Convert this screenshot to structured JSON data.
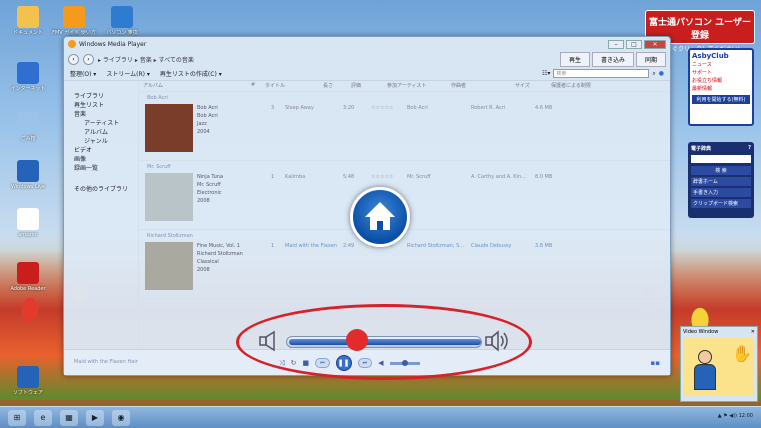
{
  "desktop": {
    "icons": [
      {
        "label": "ドキュメント",
        "color": "#f2c14e"
      },
      {
        "label": "FMV ガイド 使い方 検索",
        "color": "#f59a1c"
      },
      {
        "label": "パソコン 乗換",
        "color": "#2f7bd0"
      },
      {
        "label": "インターネット",
        "color": "#2f6fd0"
      },
      {
        "label": "ごみ箱",
        "color": "#9cc4ea"
      },
      {
        "label": "Windows Live",
        "color": "#2563b8"
      },
      {
        "label": "amazon",
        "color": "#ffffff"
      },
      {
        "label": "Adobe Reader",
        "color": "#c81e1e"
      },
      {
        "label": "ソフトウェア",
        "color": "#2563b8"
      }
    ],
    "banner": {
      "line1": "富士通パソコン ユーザー登録",
      "line2": "今すぐクリックしてください!"
    }
  },
  "gadget": {
    "brand": "AsbyClub",
    "items": [
      "ニュース",
      "サポート",
      "お役立ち情報",
      "最新情報"
    ],
    "button": "利用を開始する(無料)"
  },
  "dictionary": {
    "title": "電子辞典",
    "search": "検 索",
    "items": [
      "辞書ホーム",
      "手書き入力",
      "クリップボード検索"
    ]
  },
  "video_window": {
    "title": "Video Window"
  },
  "wmp": {
    "title": "Windows Media Player",
    "breadcrumb": "▸ ライブラリ ▸ 音楽 ▸ すべての音楽",
    "tabs": [
      "再生",
      "書き込み",
      "同期"
    ],
    "commands": [
      "整理(O) ▾",
      "ストリーム(R) ▾",
      "再生リストの作成(C) ▾"
    ],
    "search_placeholder": "検索",
    "nav": {
      "library": "ライブラリ",
      "playlists": "再生リスト",
      "music": "音楽",
      "artist": "アーティスト",
      "album": "アルバム",
      "genre": "ジャンル",
      "video": "ビデオ",
      "pictures": "画像",
      "recorded_tv": "録画一覧",
      "other": "その他のライブラリ"
    },
    "columns": [
      "アルバム",
      "#",
      "タイトル",
      "長さ",
      "評価",
      "参加アーティスト",
      "作曲者",
      "サイズ",
      "保護者による制限"
    ],
    "groups": [
      {
        "label": "Bob Acri",
        "meta": [
          "Bob Acri",
          "Bob Acri",
          "Jazz",
          "2004"
        ],
        "num": "3",
        "title": "Sleep Away",
        "length": "3:20",
        "rating": "☆☆☆☆☆",
        "artist": "Bob Acri",
        "composer": "Robert R. Acri",
        "size": "4.6 MB",
        "art": "#7a3d2a"
      },
      {
        "label": "Mr. Scruff",
        "meta": [
          "Ninja Tuna",
          "Mr. Scruff",
          "Electronic",
          "2008"
        ],
        "num": "1",
        "title": "Kalimba",
        "length": "5:48",
        "rating": "☆☆☆☆☆",
        "artist": "Mr. Scruff",
        "composer": "A. Carthy and A. Kin...",
        "size": "8.0 MB",
        "art": "#b9c4c9"
      },
      {
        "label": "Richard Stoltzman",
        "meta": [
          "Fine Music, Vol. 1",
          "Richard Stoltzman",
          "Classical",
          "2008"
        ],
        "num": "1",
        "title": "Maid with the Flaxen ...",
        "length": "2:49",
        "rating": "☆☆☆☆☆",
        "artist": "Richard Stoltzman; S...",
        "composer": "Claude Debussy",
        "size": "3.8 MB",
        "art": "#a9a9a0"
      }
    ],
    "now_playing": "Maid with the Flaxen Hair",
    "seek_progress_fraction": 0.36
  },
  "taskbar": {
    "icons": [
      "⊞",
      "e",
      "▦",
      "▶",
      "◉"
    ],
    "tray": "▲ ⚑ ◀)) 12:00"
  }
}
